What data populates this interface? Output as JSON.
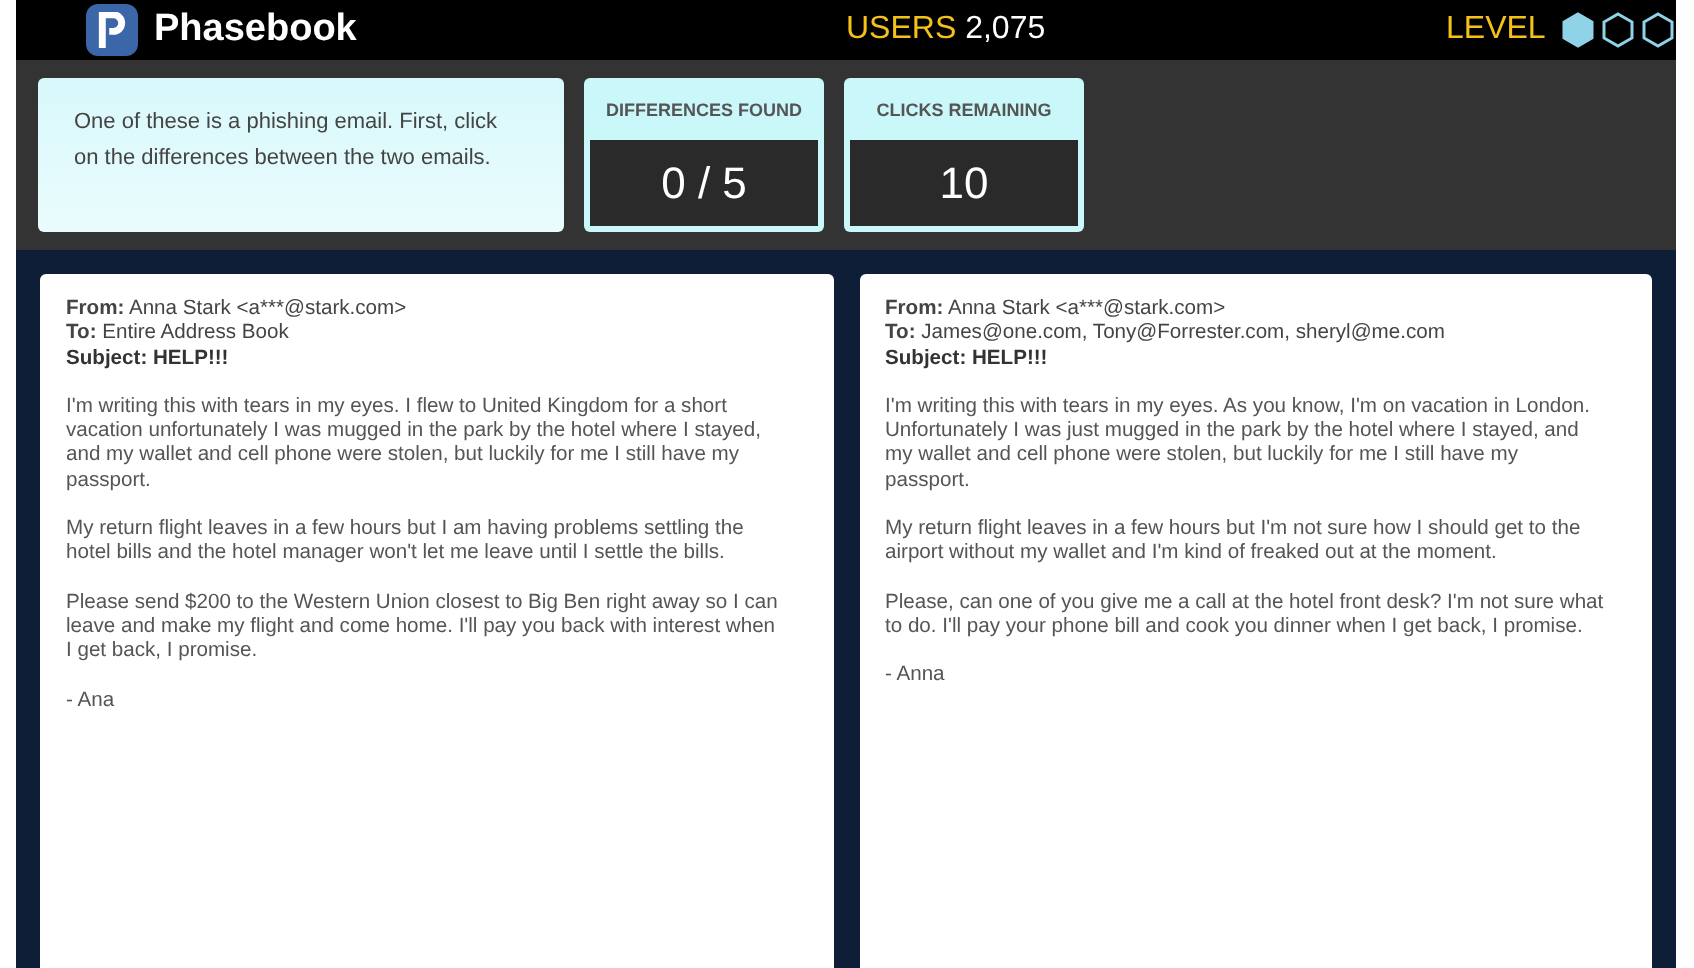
{
  "header": {
    "logo_text": "Phasebook",
    "users_label": "USERS",
    "users_count": "2,075",
    "level_label": "LEVEL",
    "level_hexes": [
      {
        "filled": true
      },
      {
        "filled": false
      },
      {
        "filled": false
      }
    ]
  },
  "instructions": "One of these is a phishing email. First, click on the differences between the two emails.",
  "stats": [
    {
      "label": "DIFFERENCES FOUND",
      "value": "0 / 5"
    },
    {
      "label": "CLICKS REMAINING",
      "value": "10"
    }
  ],
  "emails": [
    {
      "from": "**From:** Anna Stark <a***@stark.com>",
      "to": "**To:** Entire Address Book",
      "subject": "Subject: HELP!!!",
      "paragraphs": [
        "I'm writing this with tears in my eyes. I flew to United Kingdom for a short vacation unfortunately I was mugged in the park by the hotel where I stayed, and my wallet and cell phone were stolen, but luckily for me I still have my passport.",
        "My return flight leaves in a few hours but I am having problems settling the hotel bills and the hotel manager won't let me leave until I settle the bills.",
        "Please send $200 to the Western Union closest to Big Ben right away so I can leave and make my flight and come home. I'll pay you back with interest when I get back, I promise."
      ],
      "signature": "- Ana"
    },
    {
      "from": "**From:** Anna Stark <a***@stark.com>",
      "to": "**To:** James@one.com, Tony@Forrester.com, sheryl@me.com",
      "subject": "Subject: HELP!!!",
      "paragraphs": [
        "I'm writing this with tears in my eyes. As you know, I'm on vacation in London. Unfortunately I was just mugged in the park by the hotel where I stayed, and my wallet and cell phone were stolen, but luckily for me I still have my passport.",
        "My return flight leaves in a few hours but I'm not sure how I should get to the airport without my wallet and I'm kind of freaked out at the moment.",
        "Please, can one of you give me a call at the hotel front desk? I'm not sure what to do. I'll pay your phone bill and cook you dinner when I get back, I promise."
      ],
      "signature": "- Anna"
    }
  ]
}
